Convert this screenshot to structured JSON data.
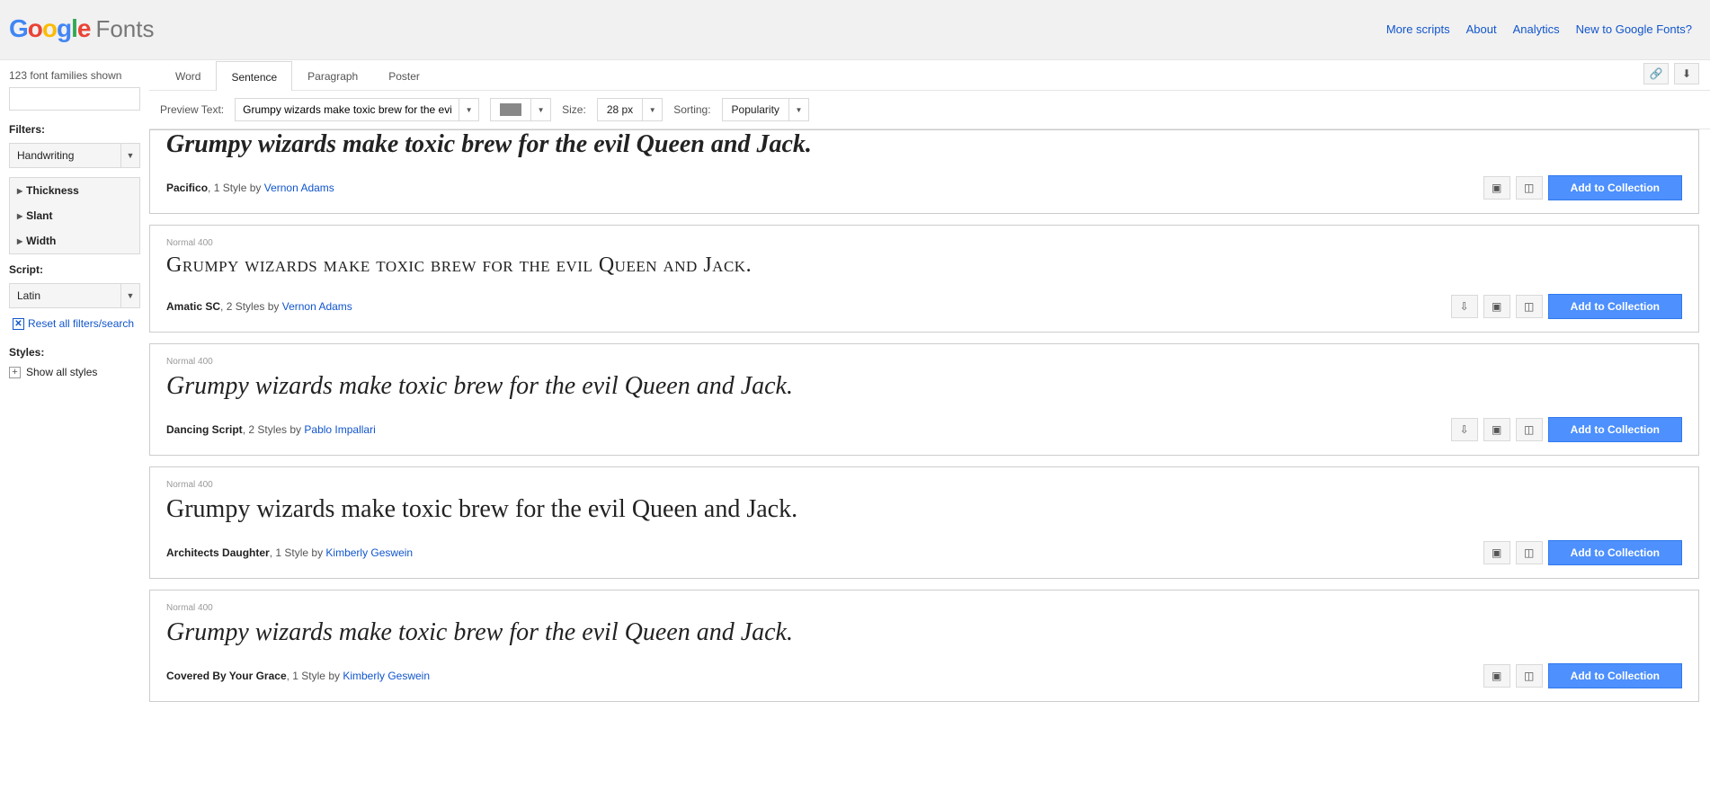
{
  "logo": {
    "fonts": "Fonts"
  },
  "header_links": [
    "More scripts",
    "About",
    "Analytics",
    "New to Google Fonts?"
  ],
  "sidebar": {
    "count": "123 font families shown",
    "filters_label": "Filters:",
    "category": "Handwriting",
    "facets": [
      "Thickness",
      "Slant",
      "Width"
    ],
    "script_label": "Script:",
    "script": "Latin",
    "reset": "Reset all filters/search",
    "styles_label": "Styles:",
    "show_all": "Show all styles"
  },
  "tabs": {
    "items": [
      "Word",
      "Sentence",
      "Paragraph",
      "Poster"
    ],
    "active": 1
  },
  "controls": {
    "preview_label": "Preview Text:",
    "preview_value": "Grumpy wizards make toxic brew for the evil",
    "size_label": "Size:",
    "size_value": "28 px",
    "sorting_label": "Sorting:",
    "sorting_value": "Popularity"
  },
  "sample_text": "Grumpy wizards make toxic brew for the evil Queen and Jack.",
  "weight_label": "Normal 400",
  "add_label": "Add to Collection",
  "fonts": [
    {
      "name": "Pacifico",
      "styles": "1 Style",
      "by": "by",
      "author": "Vernon Adams",
      "show_weight": false,
      "show_download": false,
      "sample_class": "sample-0"
    },
    {
      "name": "Amatic SC",
      "styles": "2 Styles",
      "by": "by",
      "author": "Vernon Adams",
      "show_weight": true,
      "show_download": true,
      "sample_class": "sample-1"
    },
    {
      "name": "Dancing Script",
      "styles": "2 Styles",
      "by": "by",
      "author": "Pablo Impallari",
      "show_weight": true,
      "show_download": true,
      "sample_class": "sample-2"
    },
    {
      "name": "Architects Daughter",
      "styles": "1 Style",
      "by": "by",
      "author": "Kimberly Geswein",
      "show_weight": true,
      "show_download": false,
      "sample_class": "sample-3"
    },
    {
      "name": "Covered By Your Grace",
      "styles": "1 Style",
      "by": "by",
      "author": "Kimberly Geswein",
      "show_weight": true,
      "show_download": false,
      "sample_class": "sample-4"
    }
  ]
}
